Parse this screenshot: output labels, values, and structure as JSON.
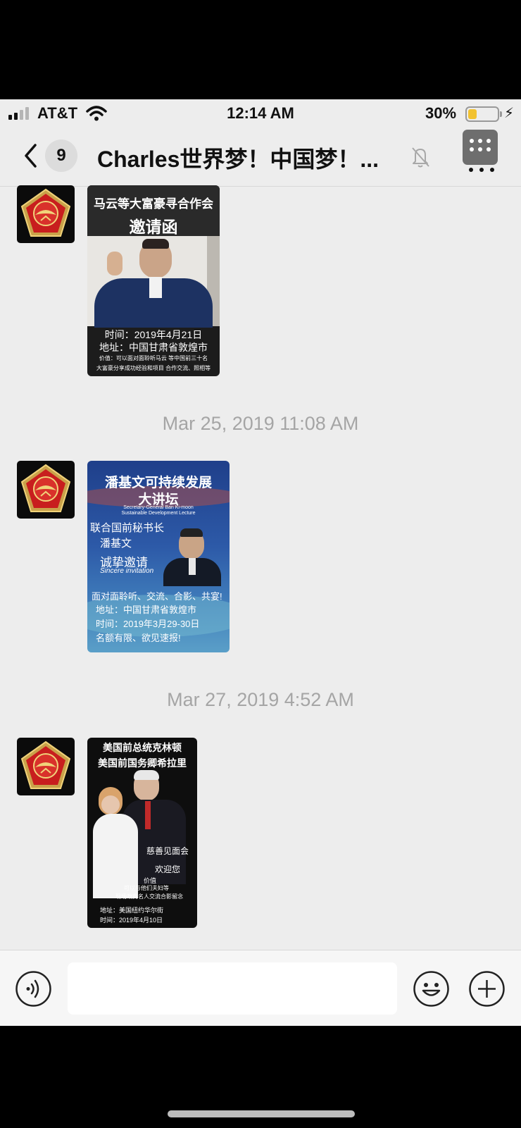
{
  "status_bar": {
    "carrier": "AT&T",
    "time": "12:14 AM",
    "battery_percent": "30%",
    "battery_level": 0.3,
    "signal_bars_active": 2,
    "signal_bars_total": 4
  },
  "nav": {
    "unread_count": "9",
    "chat_title": "Charles世界梦！中国梦！...",
    "icons": [
      "back-chevron-icon",
      "bell-muted-icon",
      "more-grid-icon"
    ]
  },
  "messages": [
    {
      "type": "image",
      "poster": {
        "heading_line1": "马云等大富豪寻合作会",
        "heading_line2": "邀请函",
        "time_line": "时间：2019年4月21日",
        "address_line": "地址：中国甘肃省敦煌市",
        "value_line1": "价值：可以面对面聆听马云 等中国前三十名",
        "value_line2": "大富豪分享成功经验和项目 合作交流、照相等"
      }
    },
    {
      "type": "timestamp",
      "text": "Mar 25, 2019 11:08 AM"
    },
    {
      "type": "image",
      "poster": {
        "title_line1": "潘基文可持续发展",
        "title_line2": "大讲坛",
        "subtitle_en1": "Secretary-General Ban Ki-moon",
        "subtitle_en2": "Sustainable Development Lecture",
        "line_un": "联合国前秘书长",
        "line_name": "潘基文",
        "line_invite": "诚挚邀请",
        "line_invite_en": "Sincere invitation",
        "line_activities": "面对面聆听、交流、合影、共宴!",
        "line_address": "地址：中国甘肃省敦煌市",
        "line_time": "时间：2019年3月29-30日",
        "line_limited": "名额有限、欲见速报!"
      }
    },
    {
      "type": "timestamp",
      "text": "Mar 27, 2019 4:52 AM"
    },
    {
      "type": "image",
      "poster": {
        "line1": "美国前总统克林顿",
        "line2": "美国前国务卿希拉里",
        "charity": "慈善见面会",
        "welcome": "欢迎您",
        "value_label": "价值",
        "value_line1": "可以与他们夫妇等",
        "value_line2": "现场政商名人交流合影留念",
        "address": "地址：美国纽约华尔街",
        "time": "时间：2019年4月10日"
      }
    }
  ],
  "input_bar": {
    "placeholder": "",
    "icons": [
      "voice-icon",
      "emoji-icon",
      "plus-icon"
    ]
  }
}
